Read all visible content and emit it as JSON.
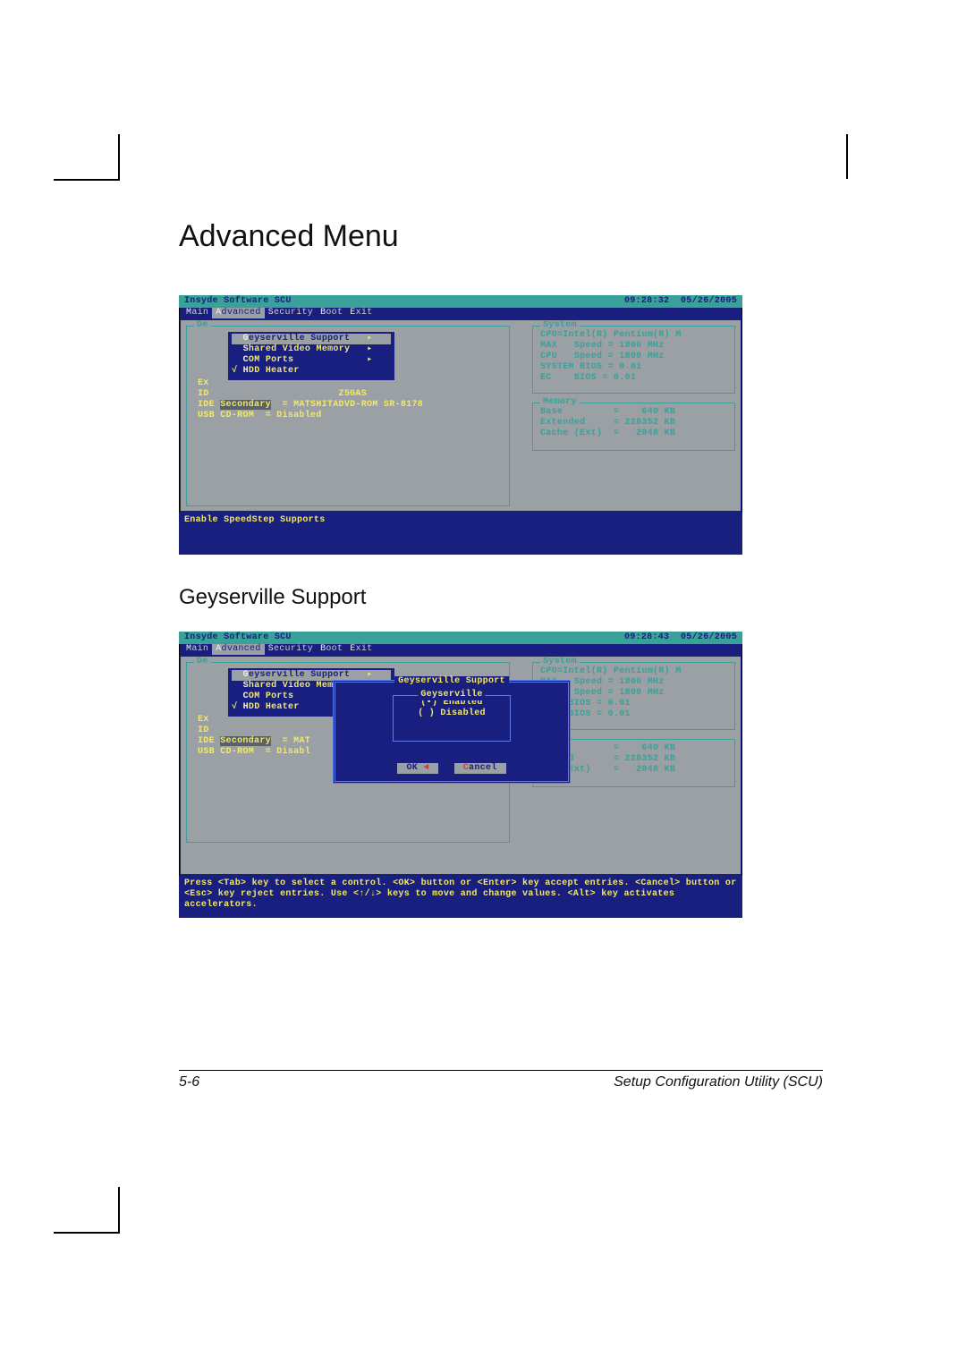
{
  "page": {
    "h1": "Advanced Menu",
    "h2": "Geyserville Support",
    "footer_left": "5-6",
    "footer_right": "Setup Configuration Utility (SCU)"
  },
  "bios1": {
    "header_left": "Insyde Software SCU",
    "header_time": "09:28:32",
    "header_date": "05/26/2005",
    "menubar": [
      "Main",
      "Advanced",
      "Security",
      "Boot",
      "Exit"
    ],
    "menu_sel_index": 1,
    "left_label": "De",
    "left_rows": [
      "Ex",
      "ID                       Z5GAS",
      "IDE Secondary  = MATSHITADVD-ROM SR-8178",
      "USB CD-ROM  = Disabled"
    ],
    "submenu": [
      {
        "label": "Geyserville Support",
        "arrow": "▸",
        "sel": true
      },
      {
        "label": "Shared Video Memory",
        "arrow": "▸"
      },
      {
        "label": "COM Ports",
        "arrow": "▸"
      },
      {
        "label": "HDD Heater",
        "check": "√"
      }
    ],
    "system_label": "System",
    "system_lines": [
      "CPU=Intel(R) Pentium(R) M",
      "MAX   Speed = 1800 MHz",
      "CPU   Speed = 1800 MHz",
      "SYSTEM BIOS = 0.01",
      "EC    BIOS = 0.01"
    ],
    "memory_label": "Memory",
    "memory_lines": [
      "Base         =    640 KB",
      "Extended     = 228352 KB",
      "Cache (Ext)  =   2048 KB"
    ],
    "helpbar": "Enable SpeedStep Supports"
  },
  "bios2": {
    "header_left": "Insyde Software SCU",
    "header_time": "09:28:43",
    "header_date": "05/26/2005",
    "menubar": [
      "Main",
      "Advanced",
      "Security",
      "Boot",
      "Exit"
    ],
    "menu_sel_index": 1,
    "left_label": "De",
    "left_rows": [
      "Ex",
      "ID",
      "IDE Secondary  = MAT",
      "USB CD-ROM  = Disabl"
    ],
    "submenu": [
      {
        "label": "Geyserville Support",
        "arrow": "▸",
        "sel": true
      },
      {
        "label": "Shared Video Memory",
        "arrow": "▸"
      },
      {
        "label": "COM Ports",
        "arrow": "▸"
      },
      {
        "label": "HDD Heater",
        "check": "√"
      }
    ],
    "system_label": "System",
    "system_lines": [
      "CPU=Intel(R) Pentium(R) M",
      "MAX   Speed = 1800 MHz",
      "U     Speed = 1800 MHz",
      "STEM BIOS = 0.01",
      "     BIOS = 0.01"
    ],
    "memory_label": "mory",
    "memory_lines": [
      "se           =    640 KB",
      "tended       = 228352 KB",
      "che (Ext)    =   2048 KB"
    ],
    "dialog": {
      "title": "Geyserville Support",
      "group": "Geyserville",
      "opt1": "(•) Enabled",
      "opt2": "( ) Disabled",
      "ok": "OK",
      "cancel": "Cancel"
    },
    "helpbar": "Press <Tab> key to select a control. <OK> button or <Enter> key accept entries. <Cancel> button or <Esc> key reject entries. Use <↑/↓> keys to move and change values. <Alt> key activates accelerators."
  }
}
